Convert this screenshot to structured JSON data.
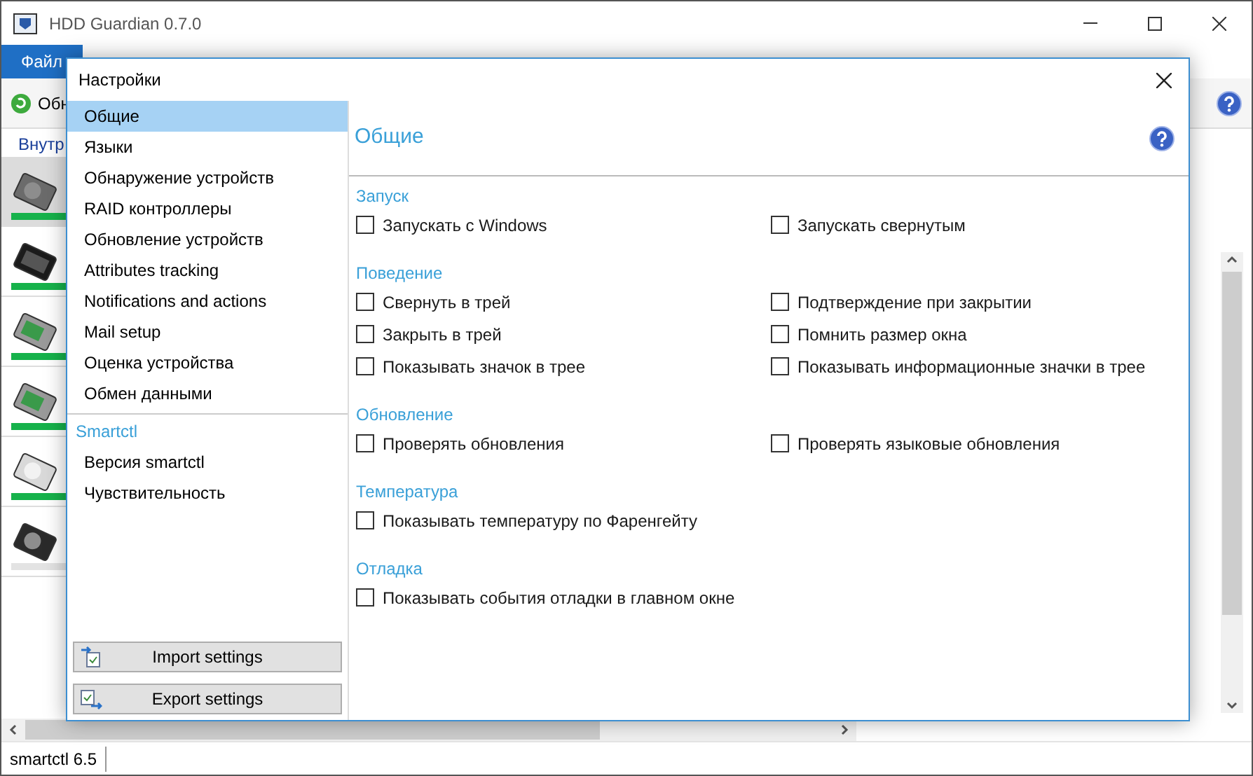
{
  "window": {
    "title": "HDD Guardian 0.7.0"
  },
  "menu": [
    {
      "label": "Файл",
      "selected": true
    }
  ],
  "toolbar": {
    "button": "Обн"
  },
  "tab": {
    "label": "Внутр"
  },
  "drives": [
    {
      "kind": "hdd",
      "selected": true,
      "color": "#16b24b"
    },
    {
      "kind": "ssd",
      "selected": false,
      "color": "#16b24b"
    },
    {
      "kind": "board",
      "selected": false,
      "color": "#16b24b"
    },
    {
      "kind": "board",
      "selected": false,
      "color": "#16b24b"
    },
    {
      "kind": "light",
      "selected": false,
      "color": "#16b24b"
    },
    {
      "kind": "dark",
      "selected": false,
      "color": "#e3e3e3"
    }
  ],
  "status_bar": "smartctl 6.5",
  "dialog": {
    "title": "Настройки",
    "sidebar": {
      "items": [
        {
          "label": "Общие",
          "selected": true
        },
        {
          "label": "Языки",
          "selected": false
        },
        {
          "label": "Обнаружение устройств",
          "selected": false
        },
        {
          "label": "RAID контроллеры",
          "selected": false
        },
        {
          "label": "Обновление устройств",
          "selected": false
        },
        {
          "label": "Attributes tracking",
          "selected": false
        },
        {
          "label": "Notifications and actions",
          "selected": false
        },
        {
          "label": "Mail setup",
          "selected": false
        },
        {
          "label": "Оценка устройства",
          "selected": false
        },
        {
          "label": "Обмен данными",
          "selected": false
        }
      ],
      "group": "Smartctl",
      "group_items": [
        {
          "label": "Версия smartctl",
          "selected": false
        },
        {
          "label": "Чувствительность",
          "selected": false
        }
      ],
      "buttons": [
        {
          "kind": "import",
          "label": "Import settings"
        },
        {
          "kind": "export",
          "label": "Export settings"
        }
      ]
    },
    "heading": "Общие",
    "sections": [
      {
        "title": "Запуск",
        "rows": [
          [
            {
              "label": "Запускать с Windows",
              "checked": false
            },
            {
              "label": "Запускать свернутым",
              "checked": false
            }
          ]
        ]
      },
      {
        "title": "Поведение",
        "rows": [
          [
            {
              "label": "Свернуть в трей",
              "checked": false
            },
            {
              "label": "Подтверждение при закрытии",
              "checked": false
            }
          ],
          [
            {
              "label": "Закрыть в трей",
              "checked": false
            },
            {
              "label": "Помнить размер окна",
              "checked": false
            }
          ],
          [
            {
              "label": "Показывать значок в трее",
              "checked": false
            },
            {
              "label": "Показывать информационные значки в трее",
              "checked": false
            }
          ]
        ]
      },
      {
        "title": "Обновление",
        "rows": [
          [
            {
              "label": "Проверять обновления",
              "checked": false
            },
            {
              "label": "Проверять языковые обновления",
              "checked": false
            }
          ]
        ]
      },
      {
        "title": "Температура",
        "rows": [
          [
            {
              "label": "Показывать температуру по Фаренгейту",
              "checked": false
            }
          ]
        ]
      },
      {
        "title": "Отладка",
        "rows": [
          [
            {
              "label": "Показывать события отладки в главном окне",
              "checked": false
            }
          ]
        ]
      }
    ]
  }
}
